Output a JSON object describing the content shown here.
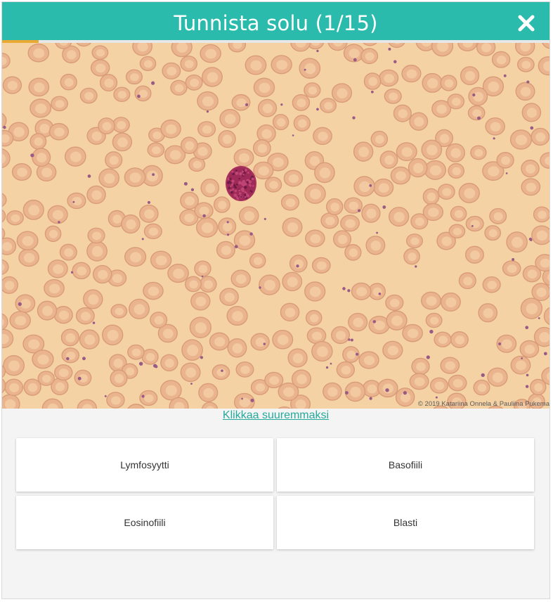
{
  "header": {
    "title": "Tunnista solu (1/15)",
    "close_icon": "close-icon",
    "progress": {
      "current": 1,
      "total": 15
    },
    "background_color": "#2bbbad"
  },
  "image": {
    "copyright": "© 2019 Katariina Onnela & Pauliina Pukema",
    "enlarge_link": "Klikkaa suuremmaksi"
  },
  "answers": [
    {
      "label": "Lymfosyytti"
    },
    {
      "label": "Basofiili"
    },
    {
      "label": "Eosinofiili"
    },
    {
      "label": "Blasti"
    }
  ],
  "colors": {
    "accent": "#2bbbad",
    "progress_fill": "#e9a935",
    "link": "#27a99b"
  }
}
